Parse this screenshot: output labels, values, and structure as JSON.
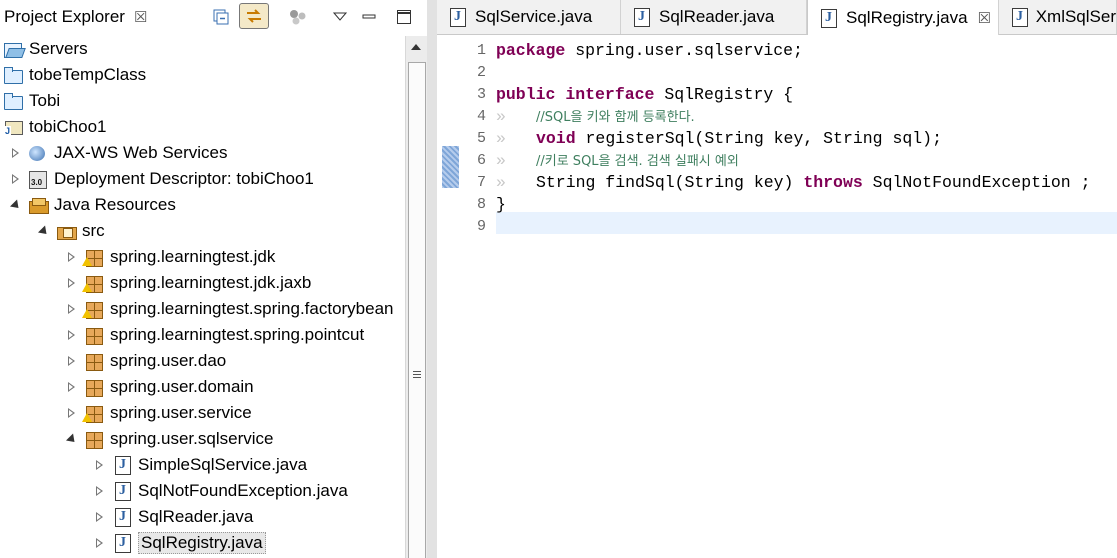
{
  "explorer": {
    "title": "Project Explorer",
    "tree": [
      {
        "label": "Servers",
        "icon": "open-folder-icon",
        "indent": 0,
        "twisty": "none"
      },
      {
        "label": "tobeTempClass",
        "icon": "folder-icon",
        "indent": 0,
        "twisty": "none"
      },
      {
        "label": "Tobi",
        "icon": "folder-icon",
        "indent": 0,
        "twisty": "none"
      },
      {
        "label": "tobiChoo1",
        "icon": "project-icon",
        "indent": 0,
        "twisty": "none"
      },
      {
        "label": "JAX-WS Web Services",
        "icon": "web-services-icon",
        "indent": 1,
        "twisty": "closed"
      },
      {
        "label": "Deployment Descriptor: tobiChoo1",
        "icon": "deployment-descriptor-icon",
        "indent": 1,
        "twisty": "closed"
      },
      {
        "label": "Java Resources",
        "icon": "java-resources-icon",
        "indent": 1,
        "twisty": "open"
      },
      {
        "label": "src",
        "icon": "source-folder-icon",
        "indent": 2,
        "twisty": "open"
      },
      {
        "label": "spring.learningtest.jdk",
        "icon": "package-warning-icon",
        "indent": 3,
        "twisty": "closed"
      },
      {
        "label": "spring.learningtest.jdk.jaxb",
        "icon": "package-warning-icon",
        "indent": 3,
        "twisty": "closed"
      },
      {
        "label": "spring.learningtest.spring.factorybean",
        "icon": "package-warning-icon",
        "indent": 3,
        "twisty": "closed"
      },
      {
        "label": "spring.learningtest.spring.pointcut",
        "icon": "package-icon",
        "indent": 3,
        "twisty": "closed"
      },
      {
        "label": "spring.user.dao",
        "icon": "package-icon",
        "indent": 3,
        "twisty": "closed"
      },
      {
        "label": "spring.user.domain",
        "icon": "package-icon",
        "indent": 3,
        "twisty": "closed"
      },
      {
        "label": "spring.user.service",
        "icon": "package-warning-icon",
        "indent": 3,
        "twisty": "closed"
      },
      {
        "label": "spring.user.sqlservice",
        "icon": "package-icon",
        "indent": 3,
        "twisty": "open"
      },
      {
        "label": "SimpleSqlService.java",
        "icon": "java-file-icon",
        "indent": 4,
        "twisty": "closed"
      },
      {
        "label": "SqlNotFoundException.java",
        "icon": "java-file-icon",
        "indent": 4,
        "twisty": "closed"
      },
      {
        "label": "SqlReader.java",
        "icon": "java-file-icon",
        "indent": 4,
        "twisty": "closed"
      },
      {
        "label": "SqlRegistry.java",
        "icon": "java-file-icon",
        "indent": 4,
        "twisty": "closed",
        "selected": true
      }
    ]
  },
  "editor": {
    "tabs": [
      {
        "label": "SqlService.java",
        "active": false
      },
      {
        "label": "SqlReader.java",
        "active": false
      },
      {
        "label": "SqlRegistry.java",
        "active": true
      },
      {
        "label": "XmlSqlSer",
        "active": false
      }
    ],
    "lines": [
      {
        "n": "1",
        "tokens": [
          {
            "t": "package",
            "c": "kw"
          },
          {
            "t": " ",
            "c": "ws"
          },
          {
            "t": "spring.user.sqlservice;",
            "c": "ty"
          }
        ]
      },
      {
        "n": "2",
        "tokens": []
      },
      {
        "n": "3",
        "tokens": [
          {
            "t": "public",
            "c": "kw"
          },
          {
            "t": " ",
            "c": "ws"
          },
          {
            "t": "interface",
            "c": "kw"
          },
          {
            "t": " SqlRegistry {",
            "c": "ty"
          }
        ]
      },
      {
        "n": "4",
        "indent": "»",
        "tokens": [
          {
            "t": "//SQL을 키와 함께 등록한다.",
            "c": "cm"
          }
        ]
      },
      {
        "n": "5",
        "indent": "»",
        "tokens": [
          {
            "t": "void",
            "c": "kw"
          },
          {
            "t": " registerSql(String key, String sql);",
            "c": "ty"
          }
        ]
      },
      {
        "n": "6",
        "indent": "»",
        "tokens": [
          {
            "t": "//키로 SQL을 검색. 검색 실패시 예외",
            "c": "cm"
          }
        ]
      },
      {
        "n": "7",
        "indent": "»",
        "tokens": [
          {
            "t": "String findSql(String key) ",
            "c": "ty"
          },
          {
            "t": "throws",
            "c": "kw"
          },
          {
            "t": " SqlNotFoundException ;",
            "c": "ty"
          }
        ]
      },
      {
        "n": "8",
        "tokens": [
          {
            "t": "}",
            "c": "ty"
          }
        ]
      },
      {
        "n": "9",
        "tokens": []
      }
    ]
  }
}
